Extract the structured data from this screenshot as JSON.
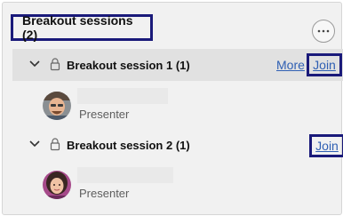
{
  "panel": {
    "title": "Breakout sessions (2)",
    "more_icon": "ellipsis-icon"
  },
  "rooms": [
    {
      "title": "Breakout session 1 (1)",
      "more_label": "More",
      "join_label": "Join",
      "member": {
        "role": "Presenter"
      }
    },
    {
      "title": "Breakout session 2 (1)",
      "join_label": "Join",
      "member": {
        "role": "Presenter"
      }
    }
  ],
  "colors": {
    "highlight_border": "#1a1a7a",
    "link": "#2f5fb3",
    "panel_bg": "#f1f1f1",
    "selected_row_bg": "#e1e1e1"
  }
}
